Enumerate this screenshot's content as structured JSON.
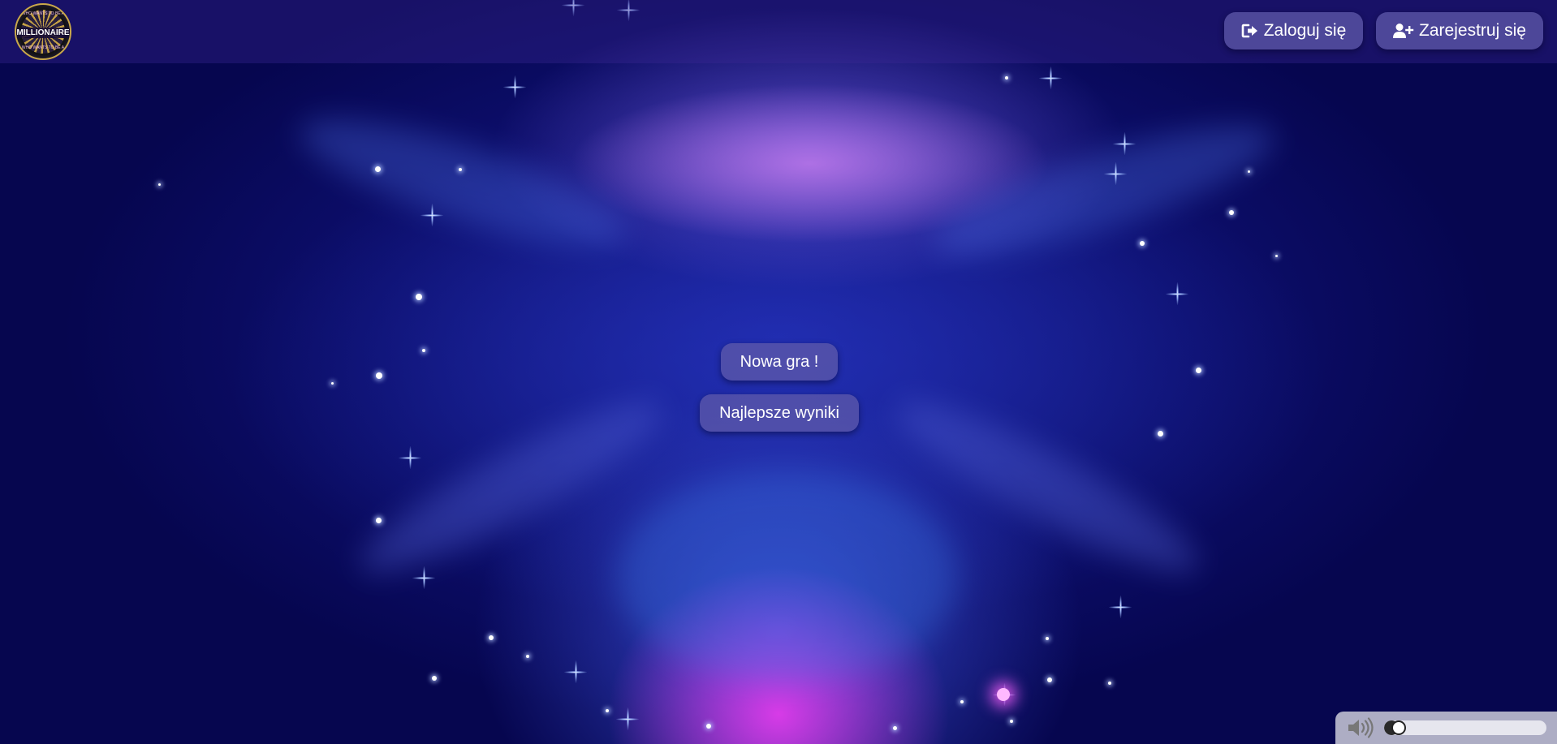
{
  "logo": {
    "main_text": "MILLIONAIRE",
    "ring_top": "WHO WANTS TO BE A",
    "ring_bottom": "WHO WANTS TO BE A"
  },
  "header": {
    "login_label": "Zaloguj się",
    "register_label": "Zarejestruj się",
    "login_icon": "sign-in-icon",
    "register_icon": "user-plus-icon"
  },
  "menu": {
    "new_game_label": "Nowa gra !",
    "best_scores_label": "Najlepsze wyniki"
  },
  "volume": {
    "icon": "volume-icon",
    "level": 0.05
  },
  "colors": {
    "button_bg": "#5f5aaa",
    "background_dark": "#06064f",
    "accent_magenta": "#e13ceb"
  }
}
